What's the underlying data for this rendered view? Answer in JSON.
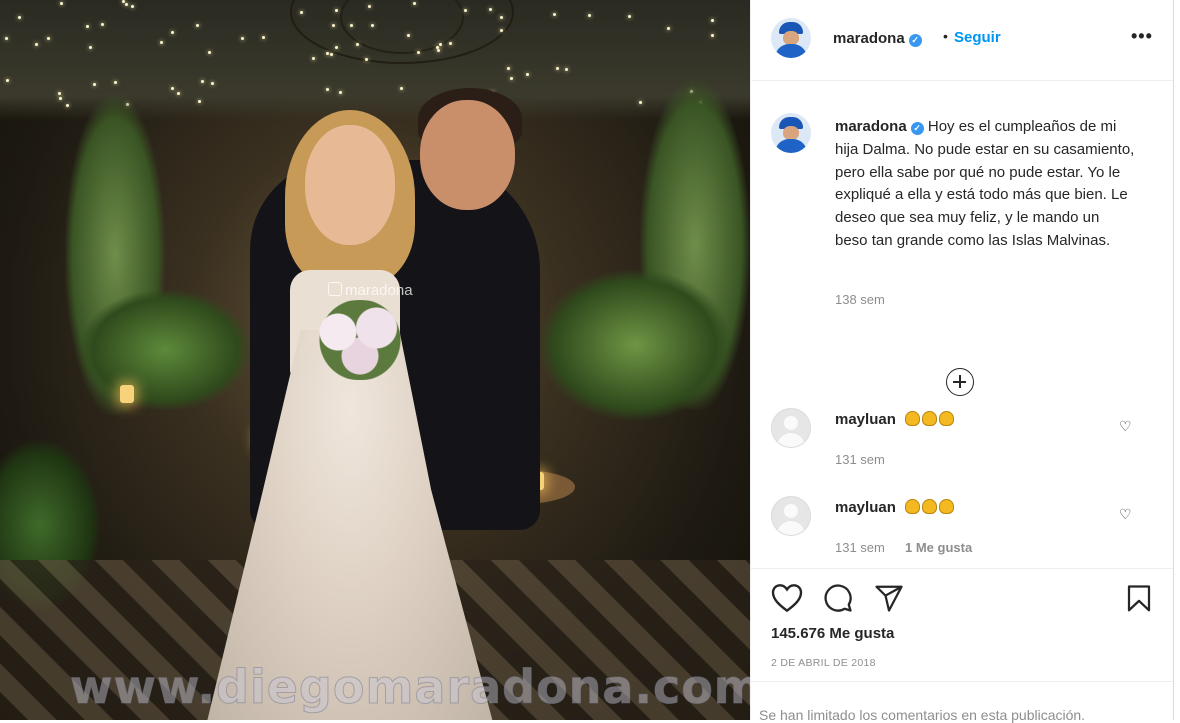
{
  "photo": {
    "tag": "maradona",
    "watermark": "www.diegomaradona.com"
  },
  "header": {
    "username": "maradona",
    "dot": "•",
    "follow_label": "Seguir",
    "more_label": "•••"
  },
  "caption": {
    "username": "maradona",
    "text": "Hoy es el cumpleaños de mi hija Dalma. No pude estar en su casamiento, pero ella sabe por qué no pude estar. Yo le expliqué a ella y está todo más que bien. Le deseo que sea muy feliz, y le mando un beso tan grande como las Islas Malvinas.",
    "age": "138 sem"
  },
  "comments": [
    {
      "username": "mayluan",
      "emoji_count": 3,
      "age": "131 sem",
      "likes": ""
    },
    {
      "username": "mayluan",
      "emoji_count": 3,
      "age": "131 sem",
      "likes": "1 Me gusta"
    }
  ],
  "stats": {
    "likes": "145.676 Me gusta",
    "date": "2 DE ABRIL DE 2018"
  },
  "footer": {
    "limited": "Se han limitado los comentarios en esta publicación."
  },
  "icons": {
    "verified": "verified-badge-icon",
    "like": "heart-icon",
    "comment": "comment-bubble-icon",
    "share": "paper-plane-icon",
    "save": "bookmark-icon",
    "add": "plus-circle-icon"
  },
  "colors": {
    "accent": "#0095f6",
    "verified": "#3897f0",
    "muted": "#8e8e8e",
    "text": "#262626"
  }
}
